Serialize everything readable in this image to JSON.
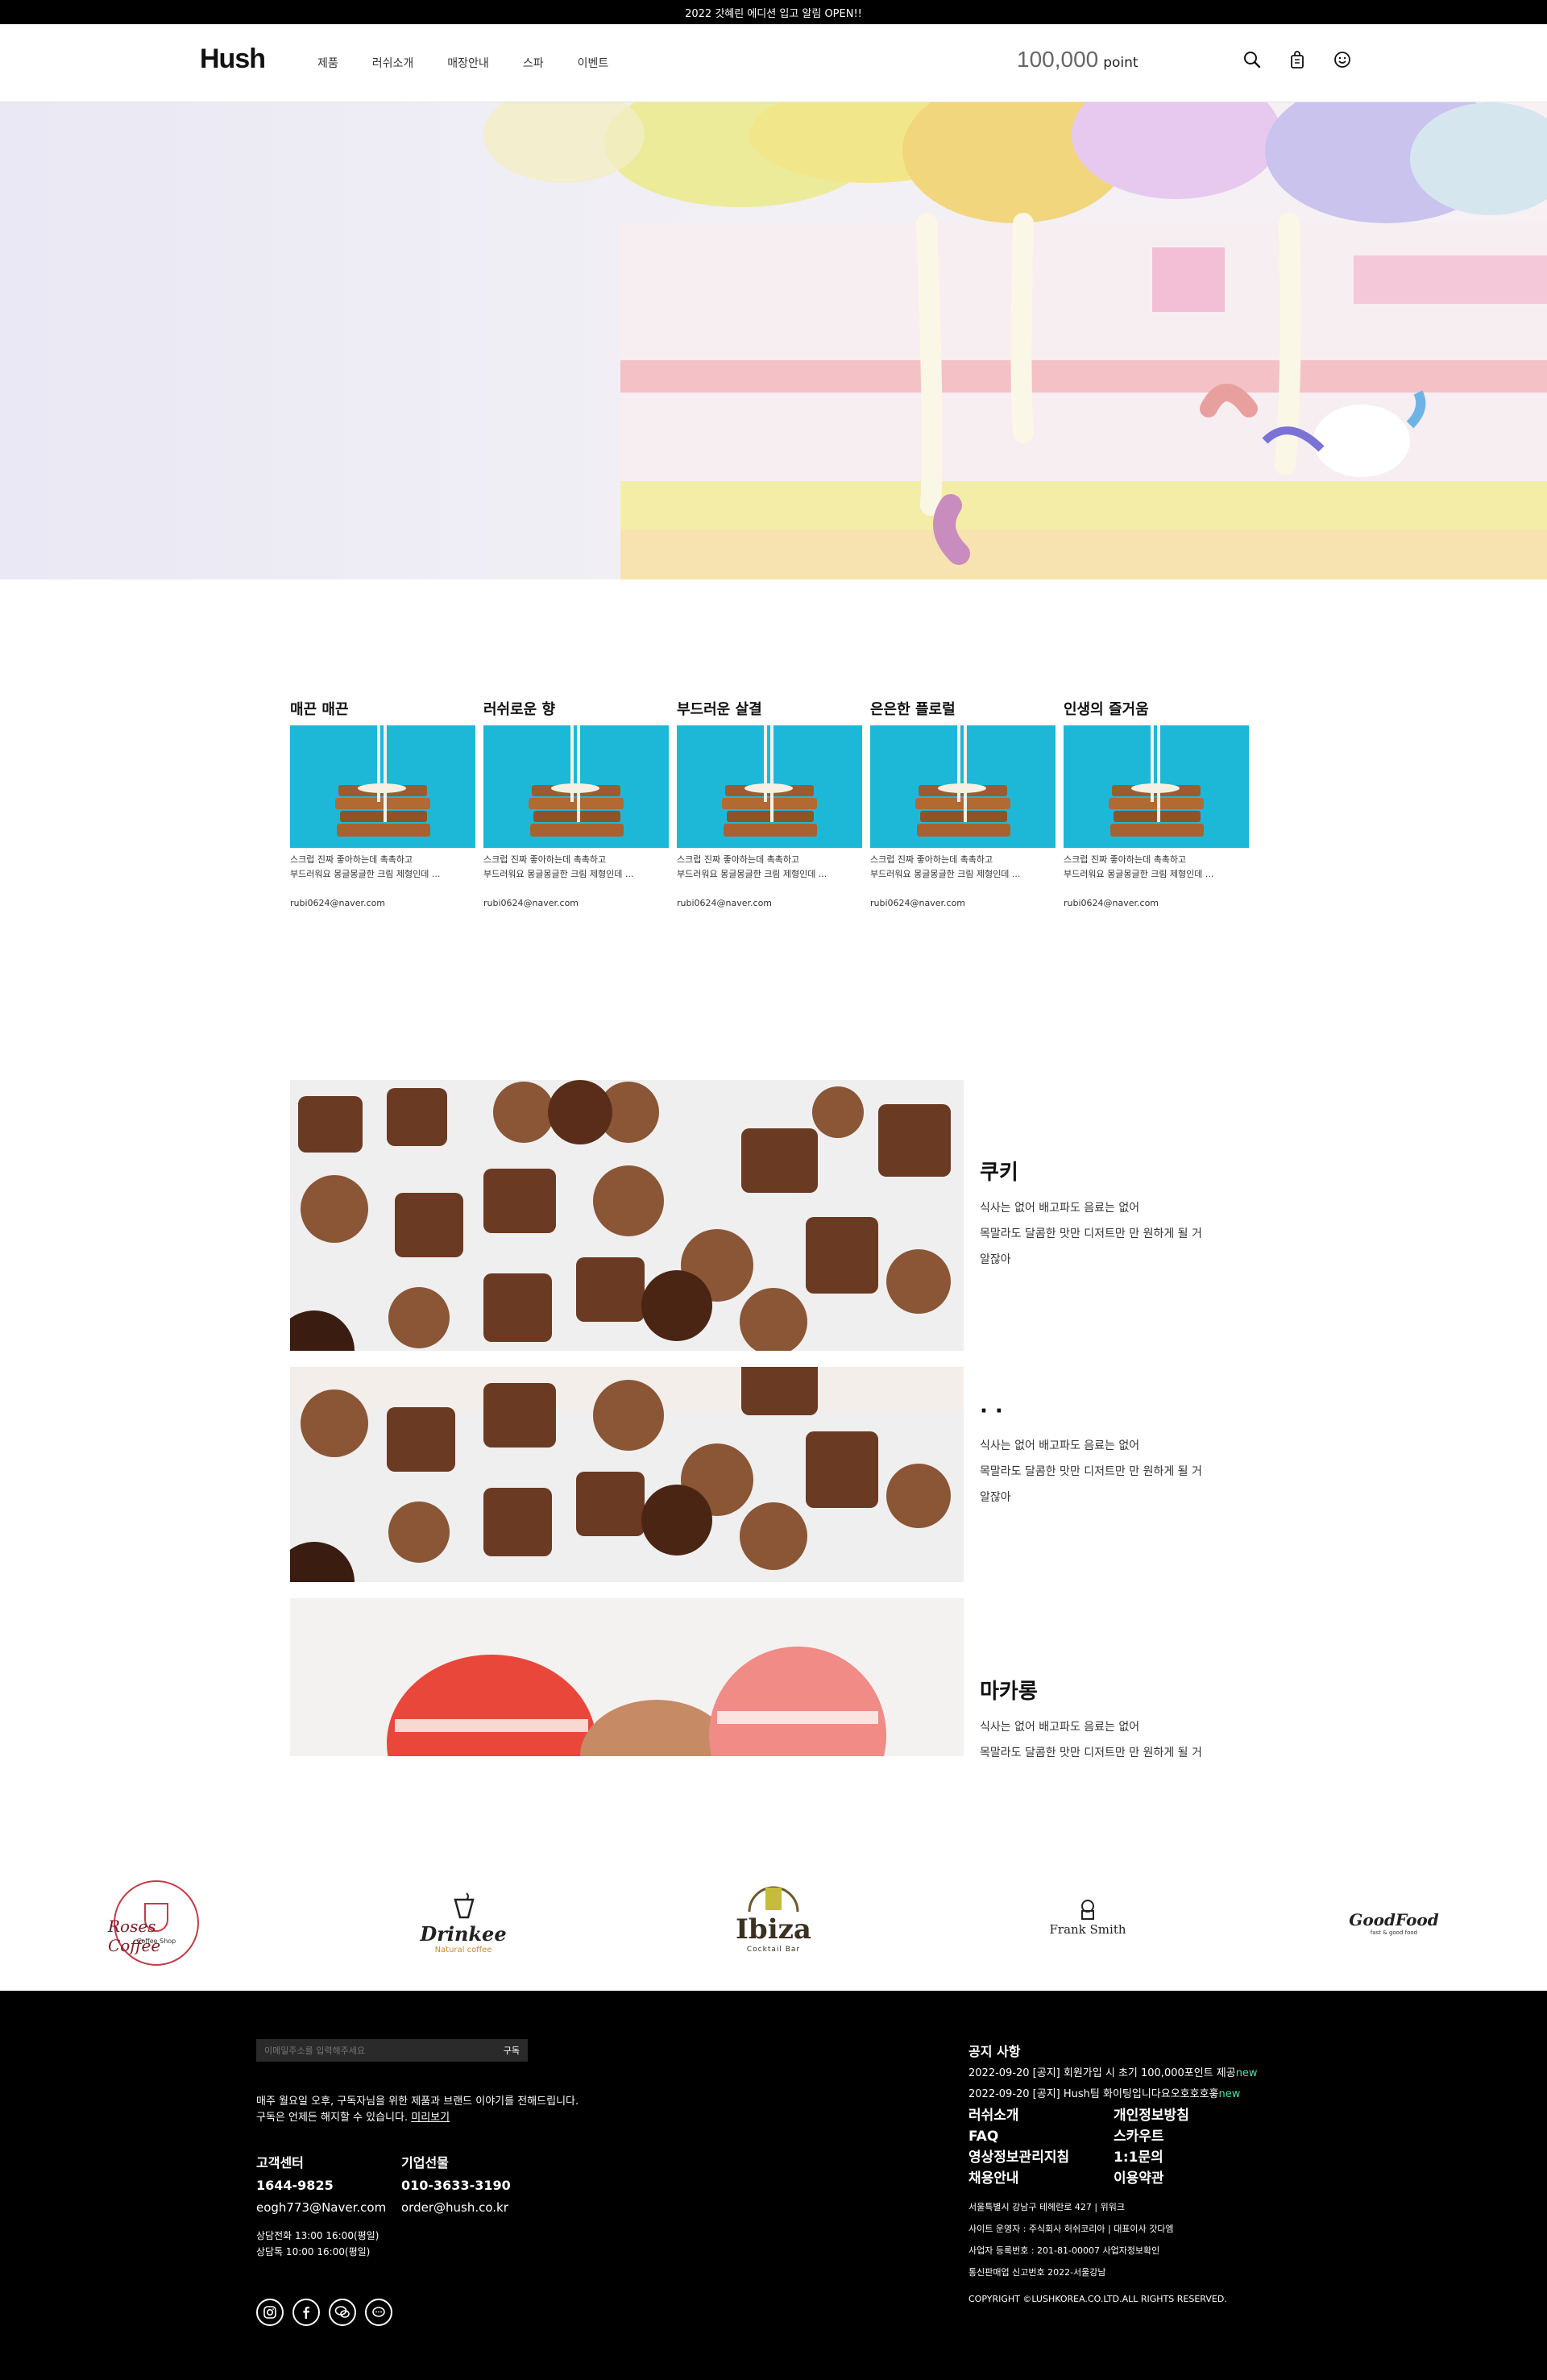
{
  "topbar": {
    "text": "2022 갓혜린 에디션 입고 알림 OPEN!!"
  },
  "header": {
    "logo": "Hush",
    "nav": [
      "제품",
      "러쉬소개",
      "매장안내",
      "스파",
      "이벤트"
    ],
    "point_value": "100,000",
    "point_label": "point",
    "icons": [
      "search-icon",
      "shopping-bag-icon",
      "smile-icon"
    ]
  },
  "cards": [
    {
      "title": "매끈 매끈",
      "desc1": "스크럽 진짜 좋아하는데 촉촉하고",
      "desc2": "부드러워요 몽글몽글한 크림 제형인데 ...",
      "email": "rubi0624@naver.com"
    },
    {
      "title": "러쉬로운 향",
      "desc1": "스크럽 진짜 좋아하는데 촉촉하고",
      "desc2": "부드러워요 몽글몽글한 크림 제형인데 ...",
      "email": "rubi0624@naver.com"
    },
    {
      "title": "부드러운 살결",
      "desc1": "스크럽 진짜 좋아하는데 촉촉하고",
      "desc2": "부드러워요 몽글몽글한 크림 제형인데 ...",
      "email": "rubi0624@naver.com"
    },
    {
      "title": "은은한 플로럴",
      "desc1": "스크럽 진짜 좋아하는데 촉촉하고",
      "desc2": "부드러워요 몽글몽글한 크림 제형인데 ...",
      "email": "rubi0624@naver.com"
    },
    {
      "title": "인생의 즐거움",
      "desc1": "스크럽 진짜 좋아하는데 촉촉하고",
      "desc2": "부드러워요 몽글몽글한 크림 제형인데 ...",
      "email": "rubi0624@naver.com"
    }
  ],
  "features": [
    {
      "title": "쿠키",
      "lines": [
        "식사는 없어 배고파도 음료는 없어",
        "목말라도 달콤한 맛만 디저트만 만 원하게 될 거",
        "알잖아"
      ]
    },
    {
      "title": "· ·",
      "lines": [
        "식사는 없어 배고파도 음료는 없어",
        "목말라도 달콤한 맛만 디저트만 만 원하게 될 거",
        "알잖아"
      ]
    },
    {
      "title": "마카롱",
      "lines": [
        "식사는 없어 배고파도 음료는 없어",
        "목말라도 달콤한 맛만 디저트만 만 원하게 될 거"
      ]
    }
  ],
  "brands": [
    {
      "name": "Roses Coffee",
      "sub": "Coffee Shop"
    },
    {
      "name": "Drinkee",
      "sub": "Natural coffee"
    },
    {
      "name": "Ibiza",
      "sub": "Cocktail Bar"
    },
    {
      "name": "Frank Smith",
      "sub": ""
    },
    {
      "name": "GoodFood",
      "sub": "fast & good food"
    }
  ],
  "footer": {
    "subscribe_placeholder": "이메일주소를 입력해주세요",
    "subscribe_btn": "구독",
    "sub_desc1": "매주 월요일 오후, 구독자님을 위한 제품과 브랜드 이야기를 전해드립니다.",
    "sub_desc2": "구독은 언제든 해지할 수 있습니다.",
    "preview": "미리보기",
    "cs_title": "고객센터",
    "cs_phone": "1644-9825",
    "cs_email": "eogh773@Naver.com",
    "corp_title": "기업선물",
    "corp_phone": "010-3633-3190",
    "corp_email": "order@hush.co.kr",
    "hours1": "상담전화 13:00 16:00(평일)",
    "hours2": "상담톡 10:00 16:00(평일)",
    "notice_title": "공지 사항",
    "notice1": "2022-09-20 [공지] 회원가입 시 초기 100,000포인트 제공",
    "notice2": "2022-09-20 [공지] Hush팀 화이팅입니다요오호호호홓",
    "new_label": "new",
    "links_left": [
      "러쉬소개",
      "FAQ",
      "영상정보관리지침",
      "채용안내"
    ],
    "links_right": [
      "개인정보방침",
      "스카우트",
      "1:1문의",
      "이용약관"
    ],
    "addr": "서울특별시 강남구 테헤란로 427 | 위워크",
    "operator": "사이트 운영자 : 주식회사 허쉬코리아 | 대표이사 갓다엠",
    "bizno": "사업자 등록번호 : 201-81-00007 사업자정보확인",
    "mailorder": "통신판매업 신고번호 2022-서울강남",
    "copyright": "COPYRIGHT ©LUSHKOREA.CO.LTD.ALL RIGHTS RESERVED."
  }
}
